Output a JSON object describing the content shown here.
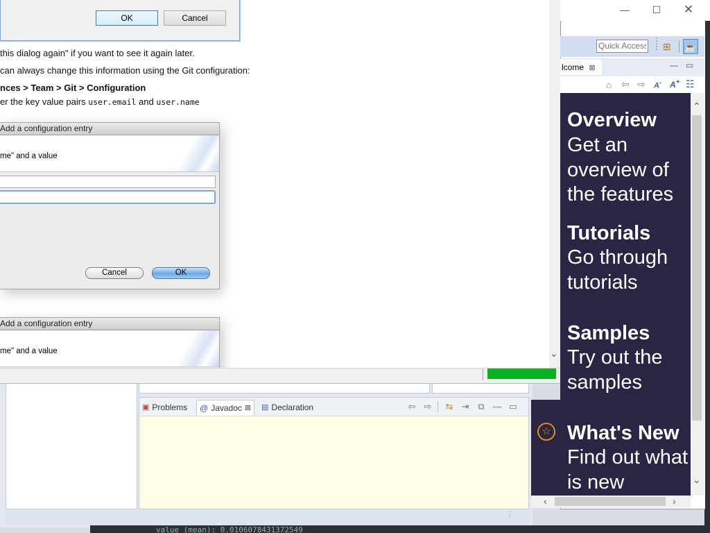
{
  "help_window": {
    "dialog_top": {
      "ok_label": "OK",
      "cancel_label": "Cancel"
    },
    "lines": [
      "this dialog again\" if you want to see it again later.",
      "can always change this information using the Git configuration:",
      "nces > Team > Git > Configuration",
      "er the key value pairs ",
      "user.email",
      " and ",
      "user.name"
    ],
    "dialog_a": {
      "title": "Add a configuration entry",
      "message": "me\" and a value",
      "cancel_label": "Cancel",
      "ok_label": "OK"
    },
    "dialog_b": {
      "title": "Add a configuration entry",
      "message": "me\" and a value"
    }
  },
  "welcome": {
    "quick_access_placeholder": "Quick Access",
    "tab_label": "lcome",
    "sections": [
      {
        "title": "Overview",
        "description": "Get an overview of the features"
      },
      {
        "title": "Tutorials",
        "description": "Go through tutorials"
      },
      {
        "title": "Samples",
        "description": "Try out the samples"
      },
      {
        "title": "What's New",
        "description": "Find out what is new"
      }
    ]
  },
  "views": {
    "tabs": [
      "Problems",
      "Javadoc",
      "Declaration"
    ],
    "active_tab": "Javadoc"
  },
  "console_line": "value (mean): 0.0106078431372549",
  "colors": {
    "welcome_bg": "#2a2543",
    "progress": "#06b025",
    "javadoc_bg": "#ffffe8"
  }
}
